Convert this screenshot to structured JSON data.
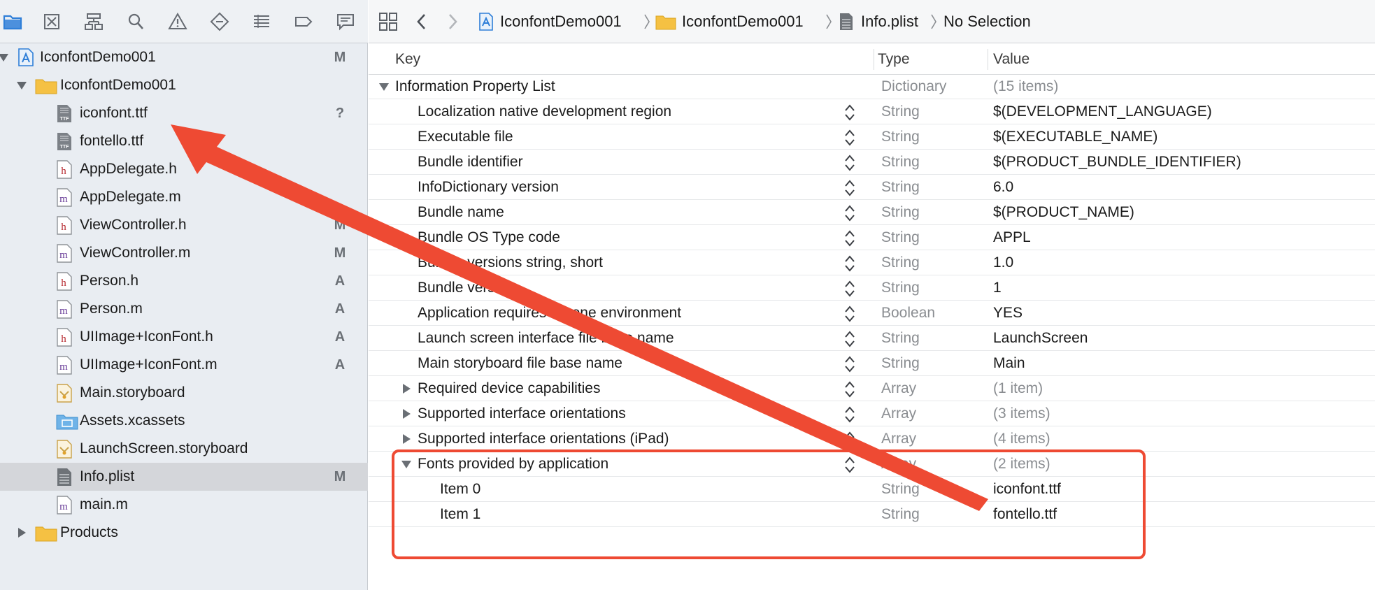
{
  "navigator": {
    "toolbar_icons": [
      "folder-icon",
      "source-control-icon",
      "hierarchy-icon",
      "search-icon",
      "warning-icon",
      "test-diamond-icon",
      "debug-list-icon",
      "breakpoint-icon",
      "report-icon"
    ],
    "tree": [
      {
        "label": "IconfontDemo001",
        "status": "M",
        "kind": "project",
        "level": 0,
        "disclosure": "open"
      },
      {
        "label": "IconfontDemo001",
        "status": "",
        "kind": "folder",
        "level": 1,
        "disclosure": "open"
      },
      {
        "label": "iconfont.ttf",
        "status": "?",
        "kind": "ttf",
        "level": 2
      },
      {
        "label": "fontello.ttf",
        "status": "",
        "kind": "ttf",
        "level": 2
      },
      {
        "label": "AppDelegate.h",
        "status": "",
        "kind": "h",
        "level": 2
      },
      {
        "label": "AppDelegate.m",
        "status": "",
        "kind": "m",
        "level": 2
      },
      {
        "label": "ViewController.h",
        "status": "M",
        "kind": "h",
        "level": 2
      },
      {
        "label": "ViewController.m",
        "status": "M",
        "kind": "m",
        "level": 2
      },
      {
        "label": "Person.h",
        "status": "A",
        "kind": "h",
        "level": 2
      },
      {
        "label": "Person.m",
        "status": "A",
        "kind": "m",
        "level": 2
      },
      {
        "label": "UIImage+IconFont.h",
        "status": "A",
        "kind": "h",
        "level": 2
      },
      {
        "label": "UIImage+IconFont.m",
        "status": "A",
        "kind": "m",
        "level": 2
      },
      {
        "label": "Main.storyboard",
        "status": "",
        "kind": "storyboard",
        "level": 2
      },
      {
        "label": "Assets.xcassets",
        "status": "",
        "kind": "assets",
        "level": 2
      },
      {
        "label": "LaunchScreen.storyboard",
        "status": "",
        "kind": "storyboard",
        "level": 2
      },
      {
        "label": "Info.plist",
        "status": "M",
        "kind": "plist",
        "level": 2,
        "selected": true
      },
      {
        "label": "main.m",
        "status": "",
        "kind": "m",
        "level": 2
      },
      {
        "label": "Products",
        "status": "",
        "kind": "folder",
        "level": 1,
        "disclosure": "closed"
      }
    ]
  },
  "jumpbar": {
    "crumbs": [
      "IconfontDemo001",
      "IconfontDemo001",
      "Info.plist",
      "No Selection"
    ]
  },
  "plist": {
    "headers": {
      "key": "Key",
      "type": "Type",
      "value": "Value"
    },
    "rows": [
      {
        "key": "Information Property List",
        "type": "Dictionary",
        "value": "(15 items)",
        "level": 0,
        "disclosure": "open",
        "muted_value": true,
        "stepper": false
      },
      {
        "key": "Localization native development region",
        "type": "String",
        "value": "$(DEVELOPMENT_LANGUAGE)",
        "level": 1,
        "stepper": true
      },
      {
        "key": "Executable file",
        "type": "String",
        "value": "$(EXECUTABLE_NAME)",
        "level": 1,
        "stepper": true
      },
      {
        "key": "Bundle identifier",
        "type": "String",
        "value": "$(PRODUCT_BUNDLE_IDENTIFIER)",
        "level": 1,
        "stepper": true
      },
      {
        "key": "InfoDictionary version",
        "type": "String",
        "value": "6.0",
        "level": 1,
        "stepper": true
      },
      {
        "key": "Bundle name",
        "type": "String",
        "value": "$(PRODUCT_NAME)",
        "level": 1,
        "stepper": true
      },
      {
        "key": "Bundle OS Type code",
        "type": "String",
        "value": "APPL",
        "level": 1,
        "stepper": true
      },
      {
        "key": "Bundle versions string, short",
        "type": "String",
        "value": "1.0",
        "level": 1,
        "stepper": true
      },
      {
        "key": "Bundle version",
        "type": "String",
        "value": "1",
        "level": 1,
        "stepper": true
      },
      {
        "key": "Application requires iPhone environment",
        "type": "Boolean",
        "value": "YES",
        "level": 1,
        "stepper": true
      },
      {
        "key": "Launch screen interface file base name",
        "type": "String",
        "value": "LaunchScreen",
        "level": 1,
        "stepper": true
      },
      {
        "key": "Main storyboard file base name",
        "type": "String",
        "value": "Main",
        "level": 1,
        "stepper": true
      },
      {
        "key": "Required device capabilities",
        "type": "Array",
        "value": "(1 item)",
        "level": 1,
        "disclosure": "closed",
        "muted_value": true,
        "stepper": true
      },
      {
        "key": "Supported interface orientations",
        "type": "Array",
        "value": "(3 items)",
        "level": 1,
        "disclosure": "closed",
        "muted_value": true,
        "stepper": true
      },
      {
        "key": "Supported interface orientations (iPad)",
        "type": "Array",
        "value": "(4 items)",
        "level": 1,
        "disclosure": "closed",
        "muted_value": true,
        "stepper": true
      },
      {
        "key": "Fonts provided by application",
        "type": "Array",
        "value": "(2 items)",
        "level": 1,
        "disclosure": "open",
        "muted_value": true,
        "stepper": true
      },
      {
        "key": "Item 0",
        "type": "String",
        "value": "iconfont.ttf",
        "level": 2,
        "stepper": false
      },
      {
        "key": "Item 1",
        "type": "String",
        "value": "fontello.ttf",
        "level": 2,
        "stepper": false
      }
    ]
  },
  "annotation": {
    "color": "#ee4a33"
  },
  "colors": {
    "accent": "#2f7fd8",
    "folder": "#f5c143",
    "selected_row": "#d4d6da"
  }
}
